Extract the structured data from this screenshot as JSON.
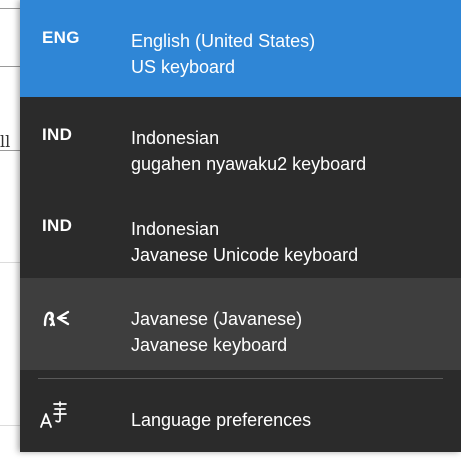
{
  "background": {
    "glyph": "ll"
  },
  "languages": [
    {
      "code": "ENG",
      "name": "English (United States)",
      "keyboard": "US keyboard",
      "state": "selected"
    },
    {
      "code": "IND",
      "name": "Indonesian",
      "keyboard": "gugahen nyawaku2 keyboard",
      "state": "normal"
    },
    {
      "code": "IND",
      "name": "Indonesian",
      "keyboard": "Javanese Unicode keyboard",
      "state": "normal"
    },
    {
      "code": "",
      "icon": "javanese-script-icon",
      "name": "Javanese (Javanese)",
      "keyboard": "Javanese keyboard",
      "state": "hovered"
    }
  ],
  "preferences": {
    "icon": "language-preferences-icon",
    "label": "Language preferences"
  },
  "colors": {
    "flyout_bg": "#2b2b2b",
    "selected_bg": "#2f86d6",
    "hovered_bg": "#3e3e3e",
    "text": "#ffffff"
  }
}
